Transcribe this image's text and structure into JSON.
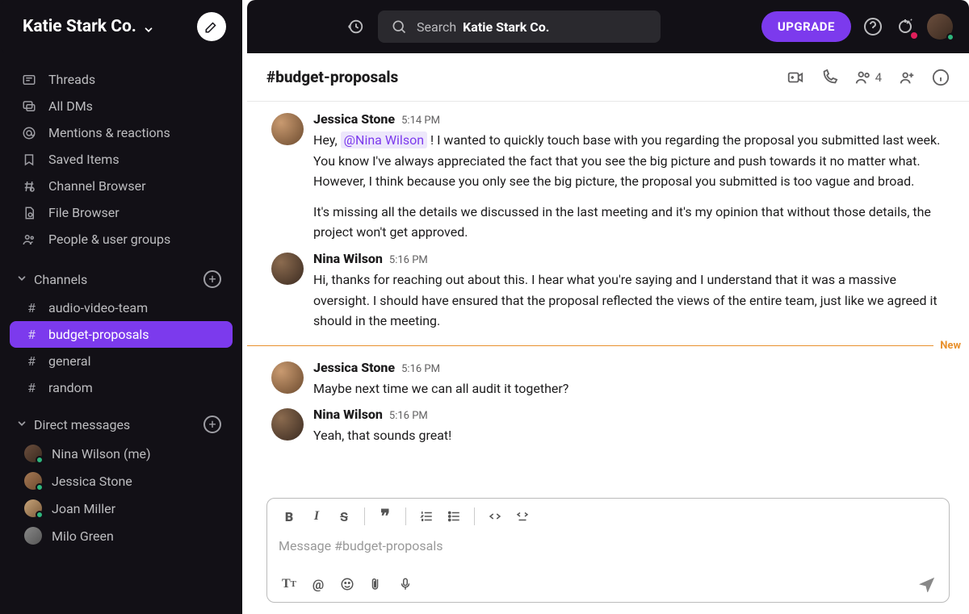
{
  "workspace": {
    "name": "Katie Stark Co."
  },
  "search": {
    "prefix": "Search",
    "bold": "Katie Stark Co."
  },
  "upgrade_label": "UPGRADE",
  "nav": {
    "threads": "Threads",
    "all_dms": "All DMs",
    "mentions": "Mentions & reactions",
    "saved": "Saved Items",
    "channel_browser": "Channel Browser",
    "file_browser": "File Browser",
    "people": "People & user groups"
  },
  "sections": {
    "channels_label": "Channels",
    "dm_label": "Direct messages"
  },
  "channels": [
    {
      "name": "audio-video-team"
    },
    {
      "name": "budget-proposals",
      "active": true
    },
    {
      "name": "general"
    },
    {
      "name": "random"
    }
  ],
  "dms": [
    {
      "name": "Nina Wilson (me)"
    },
    {
      "name": "Jessica Stone"
    },
    {
      "name": "Joan Miller"
    },
    {
      "name": "Milo Green"
    }
  ],
  "channel_header": {
    "title": "#budget-proposals",
    "member_count": "4"
  },
  "divider_new_label": "New",
  "messages": [
    {
      "author": "Jessica Stone",
      "time": "5:14 PM",
      "avatar": "ja",
      "mention_prefix": "Hey, ",
      "mention": "@Nina Wilson",
      "p1_after": " ! I wanted to quickly touch base with you regarding the proposal you submitted last week. You know I've always appreciated the fact that you see the big picture and push towards it no matter what. However, I think because you only see the big picture, the proposal you submitted is too vague and broad.",
      "p2": "It's missing all the details we discussed in the last meeting and it's my opinion that without those details, the project won't get approved."
    },
    {
      "author": "Nina Wilson",
      "time": "5:16 PM",
      "avatar": "nw",
      "p1": "Hi, thanks for reaching out about this. I hear what you're saying and I understand that it was a massive oversight. I should have ensured that the proposal reflected the views of the entire team, just like we agreed it should in the meeting."
    },
    {
      "author": "Jessica Stone",
      "time": "5:16 PM",
      "avatar": "ja",
      "p1": "Maybe next time we can all audit it together?"
    },
    {
      "author": "Nina Wilson",
      "time": "5:16 PM",
      "avatar": "nw",
      "p1": "Yeah, that sounds great!"
    }
  ],
  "composer": {
    "placeholder": "Message #budget-proposals"
  }
}
